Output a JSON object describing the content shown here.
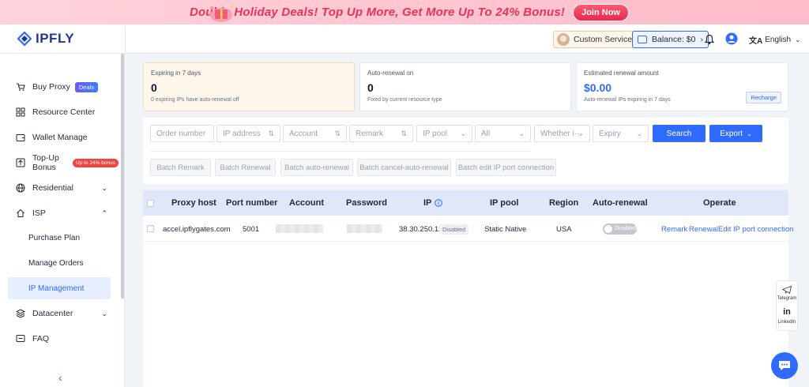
{
  "promo": {
    "text": "Double Holiday Deals! Top Up More, Get More Up To 24% Bonus!",
    "cta": "Join Now"
  },
  "brand": {
    "name": "IPFLY"
  },
  "header": {
    "custom_service": "Custom Service",
    "balance": "Balance: $0",
    "language": "English"
  },
  "sidebar": {
    "buy_proxy": "Buy Proxy",
    "deals_badge": "Deals",
    "resource_center": "Resource Center",
    "wallet_manage": "Wallet Manage",
    "topup_bonus": "Top-Up Bonus",
    "bonus_badge": "Up to 24% bonus",
    "residential": "Residential",
    "isp": "ISP",
    "purchase_plan": "Purchase Plan",
    "manage_orders": "Manage Orders",
    "ip_management": "IP Management",
    "datacenter": "Datacenter",
    "faq": "FAQ"
  },
  "cards": {
    "expiring": {
      "label": "Expiring in 7 days",
      "value": "0",
      "sub": "0 expiring IPs have auto-renewal off"
    },
    "autorenew": {
      "label": "Auto-renewal on",
      "value": "0",
      "sub": "Fixed by current resource type"
    },
    "estimated": {
      "label": "Estimated renewal amount",
      "value": "$0.00",
      "sub": "Auto-renewal IPs expiring in 7 days",
      "recharge": "Recharge"
    }
  },
  "filters": {
    "order_number": "Order number",
    "ip_address": "IP address",
    "account": "Account",
    "remark": "Remark",
    "ip_pool": "IP pool",
    "all": "All",
    "whether": "Whether i···",
    "expiry": "Expiry",
    "search": "Search",
    "export": "Export",
    "batch_remark": "Batch Remark",
    "batch_renewal": "Batch Renewal",
    "batch_auto": "Batch auto-renewal",
    "batch_cancel": "Batch cancel-auto-renewal",
    "batch_edit": "Batch edit IP port connection"
  },
  "table": {
    "headers": {
      "proxy_host": "Proxy host",
      "port": "Port number",
      "account": "Account",
      "password": "Password",
      "ip": "IP",
      "pool": "IP pool",
      "region": "Region",
      "auto": "Auto-renewal",
      "operate": "Operate"
    },
    "row": {
      "host": "accel.ipflygates.com",
      "port": "5001",
      "ip": "38.30.250.129",
      "ip_status": "Disabled",
      "pool": "Static Native",
      "region": "USA",
      "auto_status": "Disabled",
      "remark": "Remark",
      "renewal": "Renewal",
      "edit": "Edit IP port connection"
    }
  },
  "floating": {
    "telegram": "Telegram",
    "linkedin": "LinkedIn"
  },
  "colors": {
    "accent": "#2f6bff",
    "promo_text": "#e8335a",
    "badge_red": "#ef4444"
  }
}
